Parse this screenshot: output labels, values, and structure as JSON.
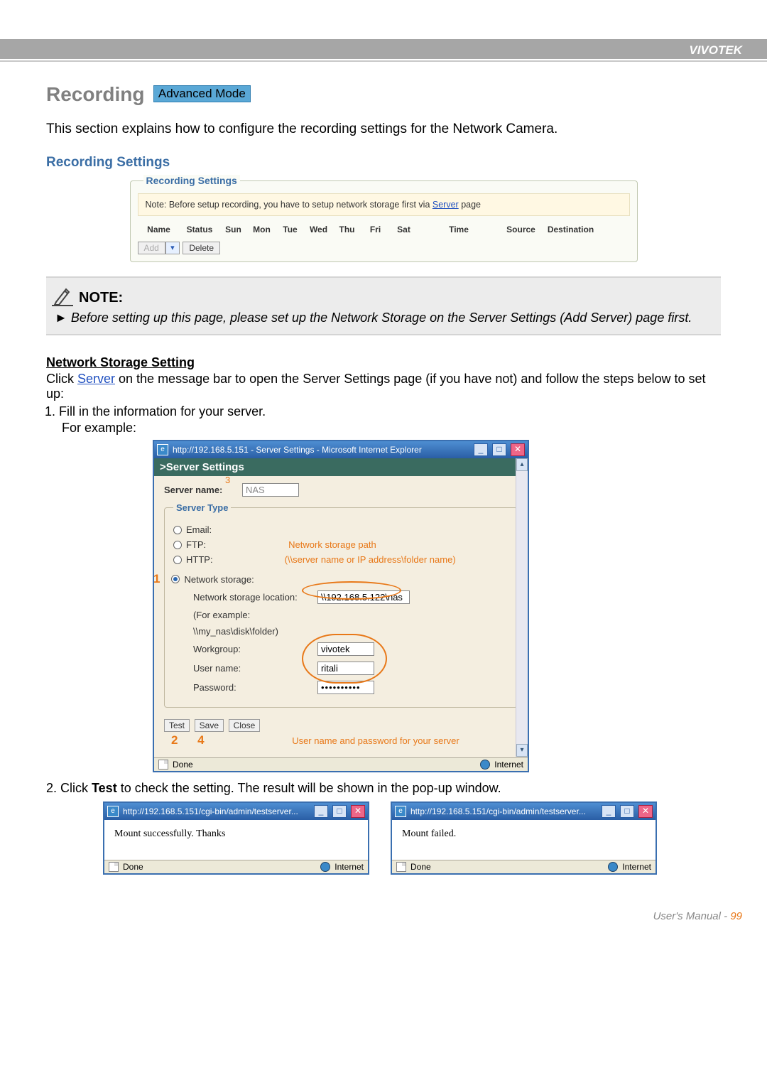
{
  "brand": "VIVOTEK",
  "heading": "Recording",
  "mode_badge": "Advanced Mode",
  "intro": "This section explains how to configure the recording settings for the Network Camera.",
  "subhead": "Recording Settings",
  "rec_panel": {
    "legend": "Recording Settings",
    "note_prefix": "Note: Before setup recording, you have to setup network storage first via ",
    "note_link": "Server",
    "note_suffix": " page",
    "cols": [
      "Name",
      "Status",
      "Sun",
      "Mon",
      "Tue",
      "Wed",
      "Thu",
      "Fri",
      "Sat",
      "Time",
      "Source",
      "Destination"
    ],
    "add": "Add",
    "delete": "Delete"
  },
  "note_block": {
    "title": "NOTE:",
    "arrow": "►",
    "body": "Before setting up this page, please set up the Network Storage on the Server Settings (Add Server) page first."
  },
  "nss": {
    "title": "Network Storage Setting",
    "click_pre": "Click ",
    "server_link": "Server",
    "click_post": " on the message bar to open the Server Settings page (if you have not) and follow the steps below to set up:",
    "step1": "Fill in the information for your server.",
    "for_example": "For example:"
  },
  "ie": {
    "title": "http://192.168.5.151 - Server Settings - Microsoft Internet Explorer",
    "heading": ">Server Settings",
    "server_name_label": "Server name:",
    "server_name_value": "NAS",
    "fieldset_legend": "Server Type",
    "opt_email": "Email:",
    "opt_ftp": "FTP:",
    "opt_http": "HTTP:",
    "opt_ns": "Network storage:",
    "loc_label": "Network storage location:",
    "loc_value": "\\\\192.168.5.122\\nas",
    "example_label": "(For example:",
    "example_value": "\\\\my_nas\\disk\\folder)",
    "workgroup_label": "Workgroup:",
    "workgroup_value": "vivotek",
    "user_label": "User name:",
    "user_value": "ritali",
    "pass_label": "Password:",
    "pass_value": "••••••••••",
    "btn_test": "Test",
    "btn_save": "Save",
    "btn_close": "Close",
    "callout1": "1",
    "callout2": "2",
    "callout3": "3",
    "callout4": "4",
    "ann_path1": "Network storage path",
    "ann_path2": "(\\\\server name or IP address\\folder name)",
    "ann_cred": "User name and password for your server",
    "status_done": "Done",
    "status_zone": "Internet"
  },
  "step2": {
    "pre": "2. Click ",
    "bold": "Test",
    "post": " to check the setting. The result will be shown in the pop-up window."
  },
  "popup": {
    "title": "http://192.168.5.151/cgi-bin/admin/testserver...",
    "msg_ok": "Mount successfully. Thanks",
    "msg_fail": "Mount failed.",
    "status_done": "Done",
    "status_zone": "Internet"
  },
  "footer": {
    "label": "User's Manual - ",
    "page": "99"
  }
}
